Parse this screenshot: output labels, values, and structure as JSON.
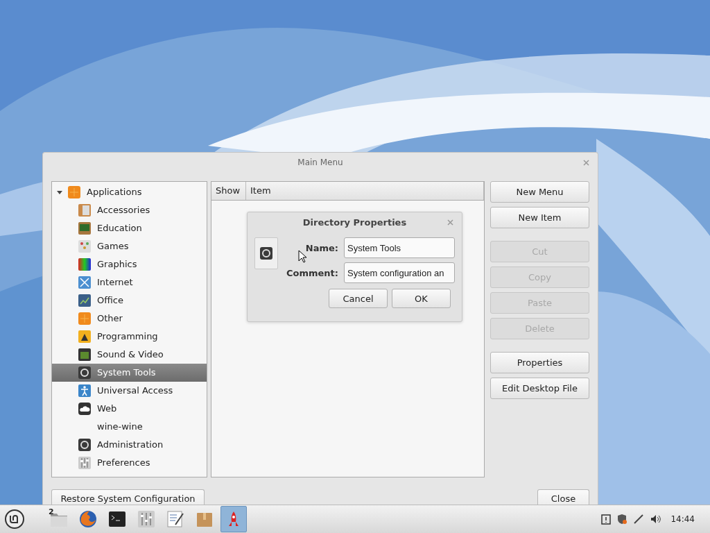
{
  "window": {
    "title": "Main Menu"
  },
  "tree": {
    "label": "Applications",
    "expanded": true,
    "children": [
      {
        "label": "Accessories",
        "selected": false
      },
      {
        "label": "Education",
        "selected": false
      },
      {
        "label": "Games",
        "selected": false
      },
      {
        "label": "Graphics",
        "selected": false
      },
      {
        "label": "Internet",
        "selected": false
      },
      {
        "label": "Office",
        "selected": false
      },
      {
        "label": "Other",
        "selected": false
      },
      {
        "label": "Programming",
        "selected": false
      },
      {
        "label": "Sound & Video",
        "selected": false
      },
      {
        "label": "System Tools",
        "selected": true
      },
      {
        "label": "Universal Access",
        "selected": false
      },
      {
        "label": "Web",
        "selected": false
      },
      {
        "label": "wine-wine",
        "selected": false
      },
      {
        "label": "Administration",
        "selected": false
      },
      {
        "label": "Preferences",
        "selected": false
      }
    ]
  },
  "table": {
    "columns": [
      "Show",
      "Item"
    ]
  },
  "button_groups": [
    [
      {
        "label": "New Menu",
        "disabled": false
      },
      {
        "label": "New Item",
        "disabled": false
      }
    ],
    [
      {
        "label": "Cut",
        "disabled": true
      },
      {
        "label": "Copy",
        "disabled": true
      },
      {
        "label": "Paste",
        "disabled": true
      },
      {
        "label": "Delete",
        "disabled": true
      }
    ],
    [
      {
        "label": "Properties",
        "disabled": false
      },
      {
        "label": "Edit Desktop File",
        "disabled": false
      }
    ]
  ],
  "footer": {
    "restore": "Restore System Configuration",
    "close": "Close"
  },
  "dialog": {
    "title": "Directory Properties",
    "fields": [
      {
        "label": "Name:",
        "value": "System Tools"
      },
      {
        "label": "Comment:",
        "value": "System configuration an"
      }
    ],
    "buttons": [
      "Cancel",
      "OK"
    ]
  },
  "taskbar": {
    "launchers": [
      {
        "kind": "folder",
        "badge": "2",
        "selected": false
      },
      {
        "kind": "browser",
        "selected": false
      },
      {
        "kind": "terminal",
        "selected": false
      },
      {
        "kind": "mixer",
        "selected": false
      },
      {
        "kind": "editor",
        "selected": false
      },
      {
        "kind": "package",
        "selected": false
      },
      {
        "kind": "rocket",
        "selected": true
      }
    ],
    "clock": "14:44"
  }
}
